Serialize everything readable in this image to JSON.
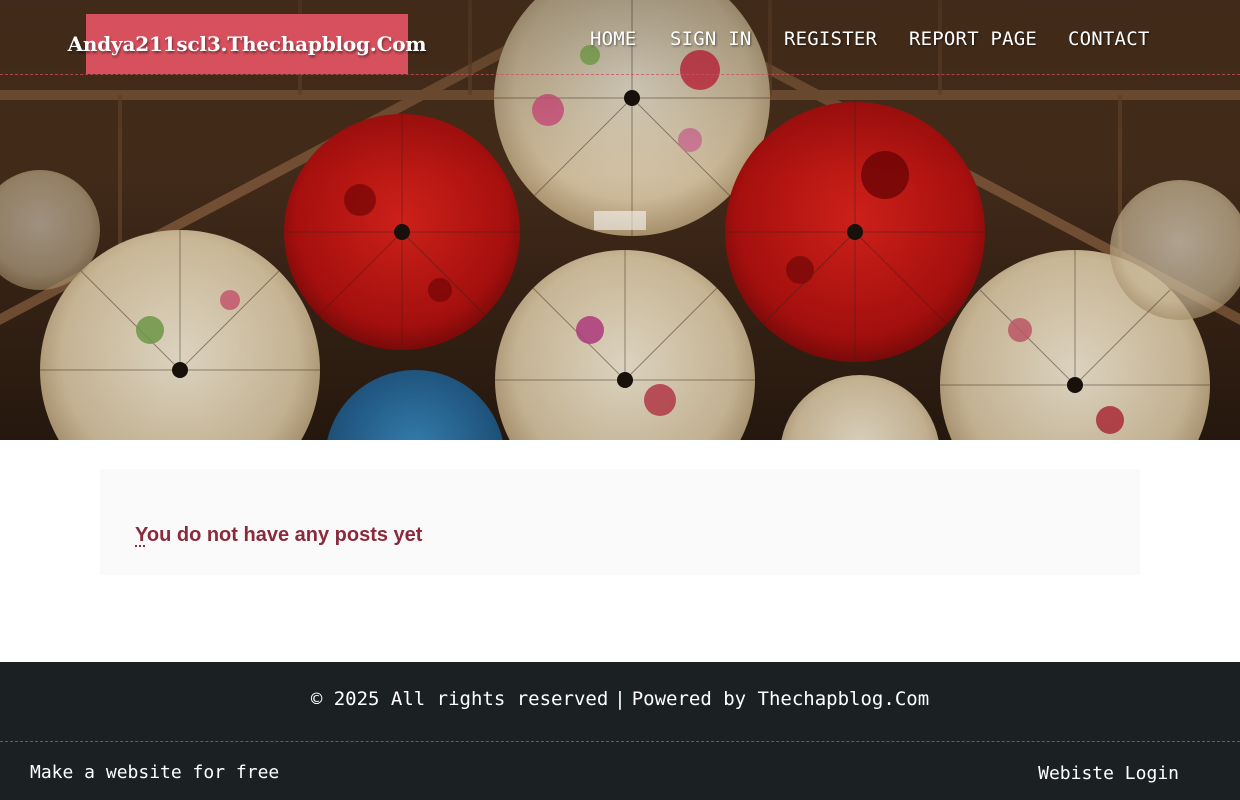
{
  "site": {
    "logo_text": "Andya211scl3.Thechapblog.Com"
  },
  "nav": {
    "items": [
      {
        "label": "HOME"
      },
      {
        "label": "SIGN IN"
      },
      {
        "label": "REGISTER"
      },
      {
        "label": "REPORT PAGE"
      },
      {
        "label": "CONTACT"
      }
    ]
  },
  "main": {
    "empty_first_letter": "Y",
    "empty_rest": "ou do not have any posts yet"
  },
  "footer": {
    "copyright": "© 2025 All rights reserved",
    "separator": "|",
    "powered_by": "Powered by Thechapblog.Com",
    "make_site_link": "Make a website for free",
    "login_link": "Webiste Login"
  },
  "colors": {
    "logo_background": "#d6505d",
    "message_text": "#8a2a3b",
    "footer_background": "#1b2022",
    "divider": "#cd505f"
  }
}
